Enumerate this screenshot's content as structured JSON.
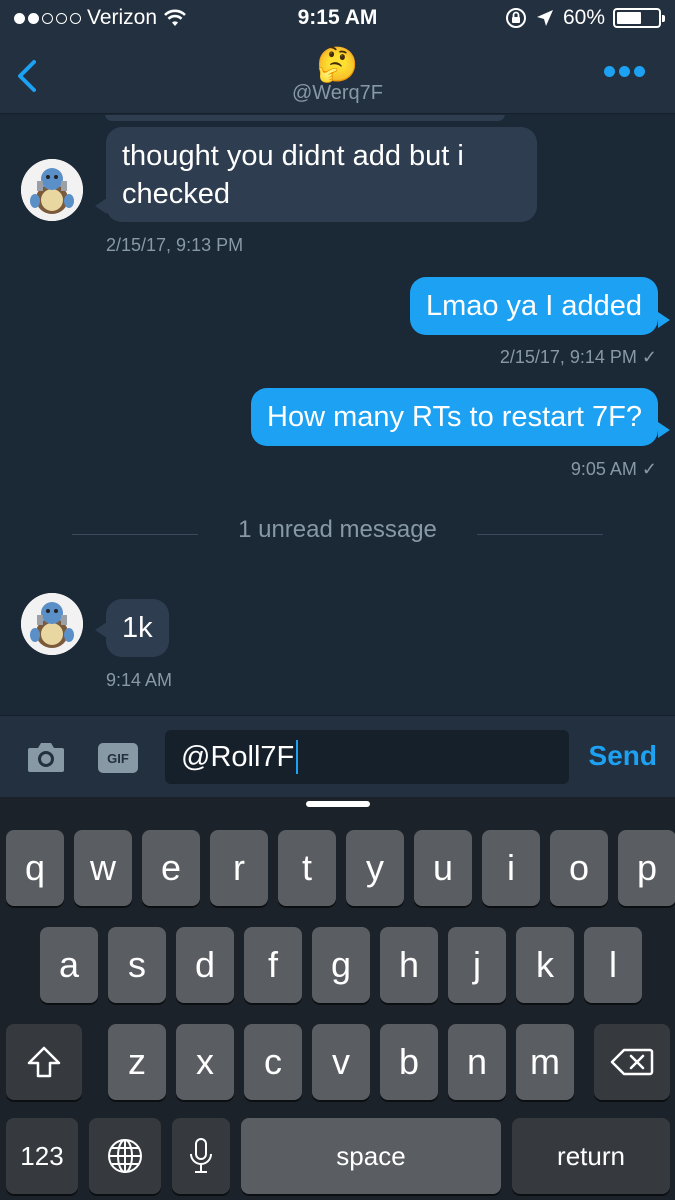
{
  "status_bar": {
    "carrier": "Verizon",
    "time": "9:15 AM",
    "battery": "60%",
    "battery_level": 0.6,
    "signal_bars": 2,
    "signal_total": 5
  },
  "nav": {
    "emoji": "🤔",
    "handle": "@Werq7F"
  },
  "messages": [
    {
      "id": "m1",
      "direction": "incoming",
      "lines": [
        "thought you didnt add but i",
        "checked"
      ],
      "timestamp": "2/15/17, 9:13 PM"
    },
    {
      "id": "m2",
      "direction": "outgoing",
      "text": "Lmao ya I added",
      "timestamp": "2/15/17, 9:14 PM ✓"
    },
    {
      "id": "m3",
      "direction": "outgoing",
      "text": "How many RTs to restart 7F?",
      "timestamp": "9:05 AM ✓"
    },
    {
      "id": "m4",
      "direction": "incoming",
      "text": "1k",
      "timestamp": "9:14 AM"
    }
  ],
  "unread_divider": "1 unread message",
  "composer": {
    "gif_label": "GIF",
    "input_value": "@Roll7F",
    "send_label": "Send"
  },
  "keyboard": {
    "row1": [
      "q",
      "w",
      "e",
      "r",
      "t",
      "y",
      "u",
      "i",
      "o",
      "p"
    ],
    "row2": [
      "a",
      "s",
      "d",
      "f",
      "g",
      "h",
      "j",
      "k",
      "l"
    ],
    "row3": [
      "z",
      "x",
      "c",
      "v",
      "b",
      "n",
      "m"
    ],
    "numbers_label": "123",
    "space_label": "space",
    "return_label": "return"
  },
  "colors": {
    "background": "#1b2836",
    "bar": "#22303f",
    "accent": "#1da1f2",
    "incoming_bubble": "#2e3d4f",
    "muted_text": "#8899a6"
  }
}
